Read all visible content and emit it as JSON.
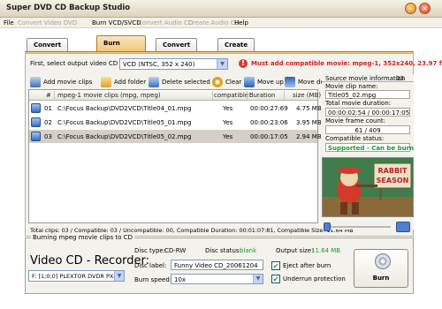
{
  "window": {
    "title": "Super DVD CD Backup Studio",
    "min_glyph": "–",
    "close_glyph": "×"
  },
  "menu": [
    {
      "label": "File",
      "enabled": true
    },
    {
      "label": "Convert Video DVD",
      "enabled": false
    },
    {
      "label": "Burn VCD/SVCD",
      "enabled": true
    },
    {
      "label": "Convert Audio CD",
      "enabled": false
    },
    {
      "label": "Create Audio CD",
      "enabled": false
    },
    {
      "label": "Help",
      "enabled": true
    }
  ],
  "tabs": [
    {
      "label": "Convert Video DVD",
      "active": false
    },
    {
      "label": "Burn VCD/SVCD",
      "active": true
    },
    {
      "label": "Convert Audio CD",
      "active": false
    },
    {
      "label": "Create Audio CD",
      "active": false
    }
  ],
  "output": {
    "label": "First, select output video CD type",
    "value": "VCD (NTSC, 352 x 240)",
    "warning_icon": "!",
    "warning": "Must add compatible movie: mpeg-1, 352x240, 23.97 fps"
  },
  "toolbar": {
    "add_clips": "Add movie clips",
    "add_folder": "Add folder",
    "delete": "Delete selected",
    "clear": "Clear",
    "move_up": "Move up",
    "move_down": "Move down"
  },
  "list": {
    "headers": {
      "num": "#",
      "file": "mpeg-1 movie clips (mpg, mpeg)",
      "compat": "compatible?",
      "duration": "duration",
      "size": "size (MB)"
    },
    "rows": [
      {
        "num": "01",
        "file": "C:\\Focus Backup\\DVD2VCD\\Title04_01.mpg",
        "compat": "Yes",
        "duration": "00:00:27:69",
        "size": "4.75 MB",
        "selected": false
      },
      {
        "num": "02",
        "file": "C:\\Focus Backup\\DVD2VCD\\Title05_01.mpg",
        "compat": "Yes",
        "duration": "00:00:23:06",
        "size": "3.95 MB",
        "selected": false
      },
      {
        "num": "03",
        "file": "C:\\Focus Backup\\DVD2VCD\\Title05_02.mpg",
        "compat": "Yes",
        "duration": "00:00:17:05",
        "size": "2.94 MB",
        "selected": true
      }
    ],
    "status": "Total clips: 03 / Compatible: 03 / Uncompatible: 00, Compatible Duration: 00:01:07:81, Compatible Size: 11.64 MB"
  },
  "info": {
    "header": "Source movie information",
    "index": "03",
    "clip_name_label": "Movie clip name:",
    "clip_name": "Title05_02.mpg",
    "total_duration_label": "Total movie duration:",
    "total_duration": "00:00:02:54 / 00:00:17:05",
    "frame_count_label": "Movie frame count:",
    "frame_count": "61 / 409",
    "compat_status_label": "Compatible status:",
    "compat_status": "Supported - Can be burn"
  },
  "preview": {
    "sign_line1": "RABBIT",
    "sign_line2": "SEASON"
  },
  "burn": {
    "legend": "Burning mpeg movie clips to CD",
    "recorder_title": "Video CD - Recorder:",
    "drive": "F: [1;0;0] PLEXTOR  DVDR  PX-7",
    "disc_type_label": "Disc type:",
    "disc_type": "CD-RW",
    "disc_status_label": "Disc status:",
    "disc_status": "blank",
    "output_size_label": "Output size:",
    "output_size": "11.64 MB",
    "disc_label_label": "Disc label:",
    "disc_label": "Funny Video CD_20061204",
    "burn_speed_label": "Burn speed:",
    "burn_speed": "10x",
    "eject_label": "Eject after burn",
    "underrun_label": "Underrun protection",
    "check_glyph": "✔",
    "burn_button": "Burn"
  }
}
